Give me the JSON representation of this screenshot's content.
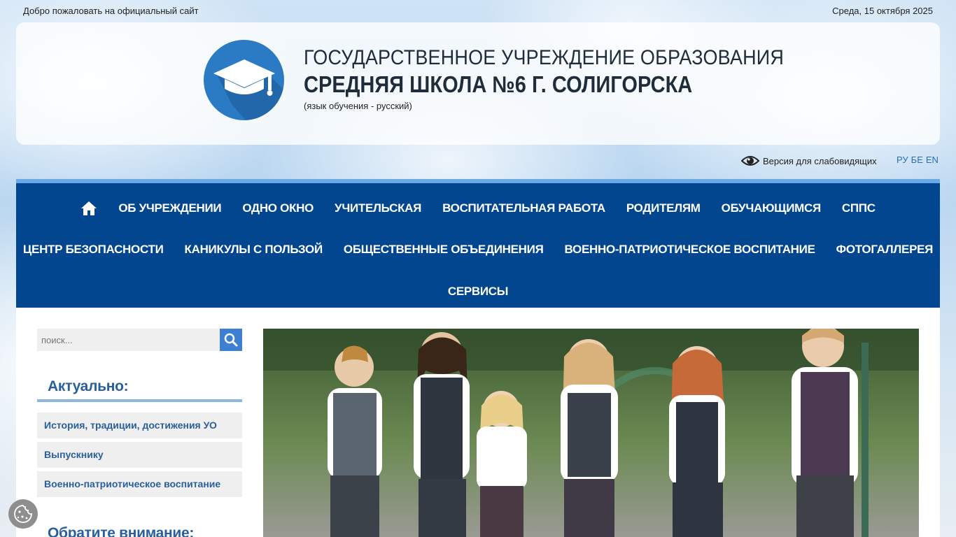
{
  "topbar": {
    "welcome": "Добро пожаловать на официальный сайт",
    "date": "Среда, 15 октября 2025"
  },
  "header": {
    "line1": "ГОСУДАРСТВЕННОЕ УЧРЕЖДЕНИЕ ОБРАЗОВАНИЯ",
    "line2": "СРЕДНЯЯ ШКОЛА №6 Г. СОЛИГОРСКА",
    "line3": "(язык обучения - русский)",
    "logo_icon": "graduation-cap-icon"
  },
  "utilities": {
    "low_vision": "Версия для слабовидящих",
    "langs": [
      "РУ",
      "БЕ",
      "EN"
    ]
  },
  "nav": {
    "row1": [
      "Об учреждении",
      "Одно окно",
      "Учительская",
      "Воспитательная работа",
      "Родителям",
      "Обучающимся",
      "СППС"
    ],
    "row2": [
      "Центр безопасности",
      "Каникулы с пользой",
      "Общественные объединения",
      "Военно-патриотическое воспитание",
      "Фотогаллерея"
    ],
    "row3": [
      "Сервисы"
    ]
  },
  "sidebar": {
    "search_placeholder": "поиск...",
    "actual_heading": "Актуально:",
    "items": [
      "История, традиции, достижения УО",
      "Выпускнику",
      "Военно-патриотическое воспитание"
    ],
    "attention_heading": "Обратите внимание:"
  },
  "colors": {
    "nav_bg": "#01468e",
    "nav_accent": "#6aa9e6",
    "link": "#2a5f9e",
    "search_btn": "#3d7fd0"
  }
}
